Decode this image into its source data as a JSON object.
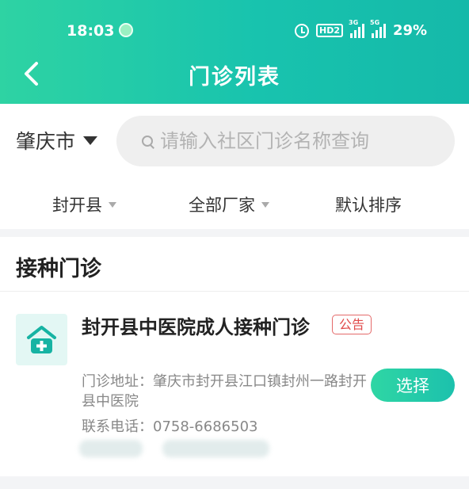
{
  "status_bar": {
    "time": "18:03",
    "hd_label": "HD2",
    "signal_1_label": "3G",
    "signal_2_label": "5G",
    "battery": "29%"
  },
  "header": {
    "title": "门诊列表"
  },
  "search": {
    "city": "肇庆市",
    "placeholder": "请输入社区门诊名称查询"
  },
  "filters": {
    "county": "封开县",
    "manufacturer": "全部厂家",
    "sort": "默认排序"
  },
  "section": {
    "title": "接种门诊"
  },
  "clinics": [
    {
      "name": "封开县中医院成人接种门诊",
      "badge": "公告",
      "address": "门诊地址：肇庆市封开县江口镇封州一路封开县中医院",
      "phone": "联系电话：0758-6686503",
      "select_label": "选择"
    }
  ],
  "colors": {
    "brand_start": "#2ed3a3",
    "brand_end": "#15b9a9",
    "badge_red": "#e04b4b"
  }
}
